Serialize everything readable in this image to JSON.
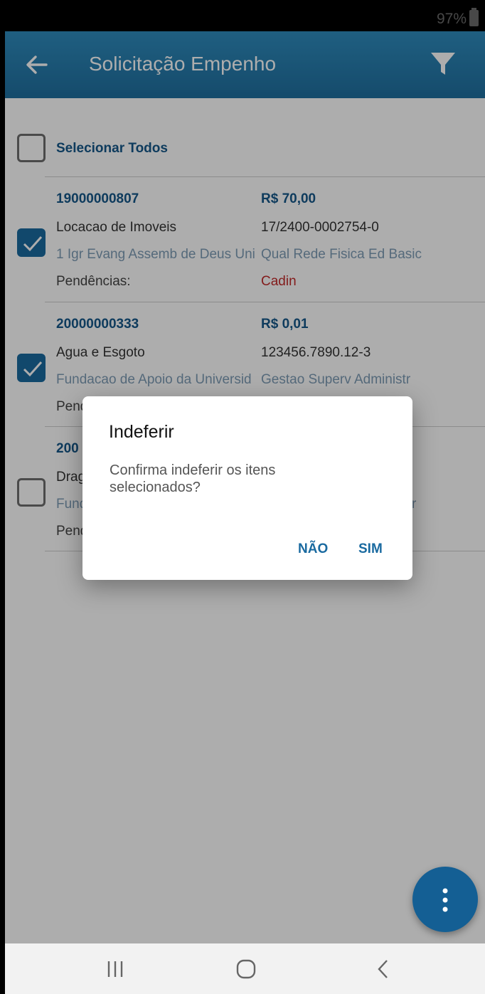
{
  "status_bar": {
    "battery": "97%"
  },
  "app_bar": {
    "title": "Solicitação Empenho",
    "icons": [
      "back-arrow-icon",
      "filter-icon"
    ]
  },
  "select_all": {
    "label": "Selecionar Todos",
    "checked": false
  },
  "items": [
    {
      "checked": true,
      "number": "19000000807",
      "value": "R$ 70,00",
      "category": "Locacao de Imoveis",
      "code": "17/2400-0002754-0",
      "entity": "1 Igr Evang Assemb de Deus Uni",
      "program": "Qual Rede Fisica Ed Basic",
      "pending_label": "Pendências:",
      "pending_value": "Cadin"
    },
    {
      "checked": true,
      "number": "20000000333",
      "value": "R$ 0,01",
      "category": "Agua e Esgoto",
      "code": "123456.7890.12-3",
      "entity": "Fundacao de Apoio da Universid",
      "program": "Gestao Superv Administr",
      "pending_label": "Pend",
      "pending_value": ""
    },
    {
      "checked": false,
      "number": "200",
      "value": "",
      "category": "Drag",
      "code": "",
      "entity": "Fund",
      "program": "r",
      "pending_label": "Pend",
      "pending_value": ""
    }
  ],
  "dialog": {
    "title": "Indeferir",
    "message": "Confirma indeferir os itens selecionados?",
    "no_label": "NÃO",
    "yes_label": "SIM"
  },
  "fab": {
    "icon": "more-vertical-icon"
  },
  "nav_bar": {
    "icons": [
      "recent-apps-icon",
      "home-icon",
      "back-icon"
    ]
  }
}
